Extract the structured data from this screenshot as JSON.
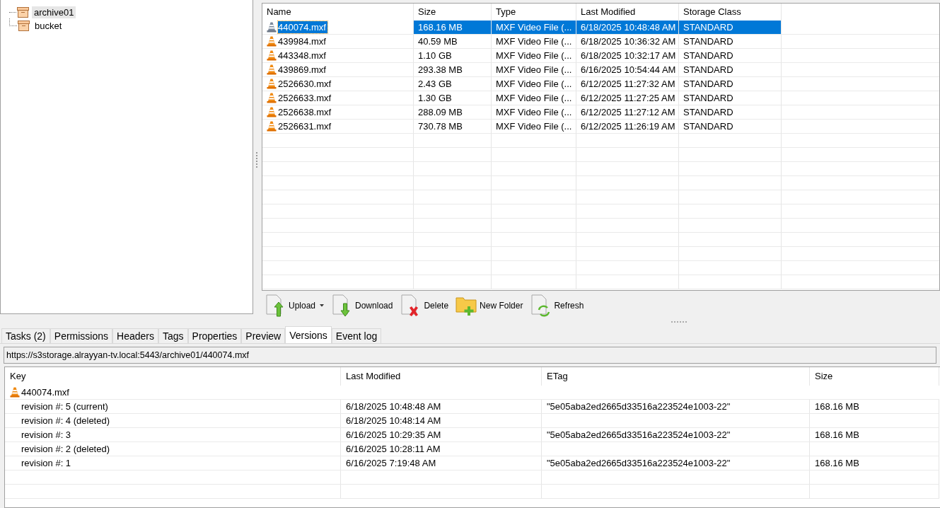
{
  "tree": [
    {
      "label": "archive01",
      "selected": true
    },
    {
      "label": "bucket",
      "selected": false
    }
  ],
  "files": {
    "columns": [
      "Name",
      "Size",
      "Type",
      "Last Modified",
      "Storage Class"
    ],
    "rows": [
      {
        "cells": [
          "440074.mxf",
          "168.16 MB",
          "MXF Video File (...",
          "6/18/2025 10:48:48 AM",
          "STANDARD"
        ],
        "selected": true
      },
      {
        "cells": [
          "439984.mxf",
          "40.59 MB",
          "MXF Video File (...",
          "6/18/2025 10:36:32 AM",
          "STANDARD"
        ],
        "selected": false
      },
      {
        "cells": [
          "443348.mxf",
          "1.10 GB",
          "MXF Video File (...",
          "6/18/2025 10:32:17 AM",
          "STANDARD"
        ],
        "selected": false
      },
      {
        "cells": [
          "439869.mxf",
          "293.38 MB",
          "MXF Video File (...",
          "6/16/2025 10:54:44 AM",
          "STANDARD"
        ],
        "selected": false
      },
      {
        "cells": [
          "2526630.mxf",
          "2.43 GB",
          "MXF Video File (...",
          "6/12/2025 11:27:32 AM",
          "STANDARD"
        ],
        "selected": false
      },
      {
        "cells": [
          "2526633.mxf",
          "1.30 GB",
          "MXF Video File (...",
          "6/12/2025 11:27:25 AM",
          "STANDARD"
        ],
        "selected": false
      },
      {
        "cells": [
          "2526638.mxf",
          "288.09 MB",
          "MXF Video File (...",
          "6/12/2025 11:27:12 AM",
          "STANDARD"
        ],
        "selected": false
      },
      {
        "cells": [
          "2526631.mxf",
          "730.78 MB",
          "MXF Video File (...",
          "6/12/2025 11:26:19 AM",
          "STANDARD"
        ],
        "selected": false
      }
    ]
  },
  "toolbar": [
    {
      "label": "Upload",
      "kind": "upload"
    },
    {
      "label": "Download",
      "kind": "download"
    },
    {
      "label": "Delete",
      "kind": "delete"
    },
    {
      "label": "New Folder",
      "kind": "folder"
    },
    {
      "label": "Refresh",
      "kind": "refresh"
    }
  ],
  "tabs": [
    {
      "label": "Tasks (2)",
      "selected": false
    },
    {
      "label": "Permissions",
      "selected": false
    },
    {
      "label": "Headers",
      "selected": false
    },
    {
      "label": "Tags",
      "selected": false
    },
    {
      "label": "Properties",
      "selected": false
    },
    {
      "label": "Preview",
      "selected": false
    },
    {
      "label": "Versions",
      "selected": true
    },
    {
      "label": "Event log",
      "selected": false
    }
  ],
  "url": "https://s3storage.alrayyan-tv.local:5443/archive01/440074.mxf",
  "versions": {
    "columns": [
      "Key",
      "Last Modified",
      "ETag",
      "Size"
    ],
    "rows": [
      {
        "kind": "file",
        "cells": [
          "440074.mxf",
          "",
          "",
          ""
        ]
      },
      {
        "kind": "revision",
        "cells": [
          "revision #: 5 (current)",
          "6/18/2025 10:48:48 AM",
          "\"5e05aba2ed2665d33516a223524e1003-22\"",
          "168.16 MB"
        ]
      },
      {
        "kind": "revision",
        "cells": [
          "revision #: 4 (deleted)",
          "6/18/2025 10:48:14 AM",
          "",
          ""
        ]
      },
      {
        "kind": "revision",
        "cells": [
          "revision #: 3",
          "6/16/2025 10:29:35 AM",
          "\"5e05aba2ed2665d33516a223524e1003-22\"",
          "168.16 MB"
        ]
      },
      {
        "kind": "revision",
        "cells": [
          "revision #: 2 (deleted)",
          "6/16/2025 10:28:11 AM",
          "",
          ""
        ]
      },
      {
        "kind": "revision",
        "cells": [
          "revision #: 1",
          "6/16/2025 7:19:48 AM",
          "\"5e05aba2ed2665d33516a223524e1003-22\"",
          "168.16 MB"
        ]
      }
    ]
  }
}
